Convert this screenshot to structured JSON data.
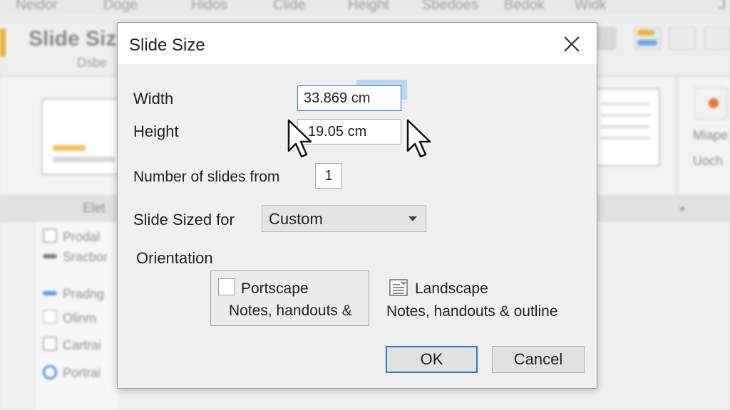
{
  "background": {
    "menu_items": [
      "Neidor",
      "Doge",
      "Hidos",
      "Clide",
      "Height",
      "Sbedoes",
      "Bedok",
      "Widk",
      "J"
    ],
    "ribbon_title": "Slide Siz",
    "ribbon_subtitle": "Dsbe",
    "group_labels": [
      "Elet"
    ],
    "list_items": [
      "Prodal",
      "Sracbor",
      "Pradng",
      "Olinm",
      "Cartrai",
      "Portrai"
    ],
    "side_texts": [
      "Miape",
      "Uoch"
    ]
  },
  "dialog": {
    "title": "Slide Size",
    "close_glyph": "✕",
    "width_label": "Width",
    "width_value": "33.869 cm",
    "height_label": "Height",
    "height_value": "19.05 cm",
    "slides_label": "Number of slides from",
    "slides_value": "1",
    "sized_for_label": "Slide Sized for",
    "sized_for_value": "Custom",
    "orientation_label": "Orientation",
    "portrait": {
      "name": "Portscape",
      "desc": "Notes, handouts &"
    },
    "landscape": {
      "name": "Landscape",
      "desc": "Notes, handouts & outline"
    },
    "ok_label": "OK",
    "cancel_label": "Cancel"
  },
  "colors": {
    "accent": "#2f78d0",
    "selection": "#bcd7f3",
    "dialog_bg": "#f0f0f0"
  },
  "icons": [
    "close-icon",
    "dropdown-caret-icon",
    "checkbox-icon",
    "landscape-document-icon",
    "mouse-pointer-icon"
  ]
}
